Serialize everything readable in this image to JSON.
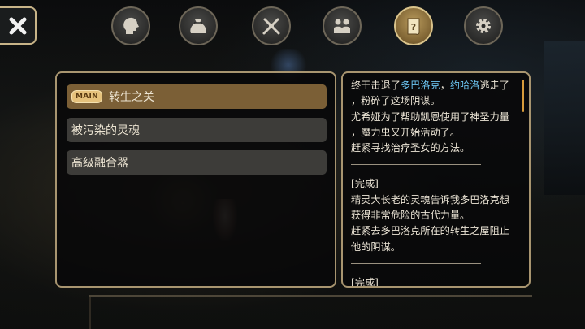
{
  "nav": {
    "close_icon": "close-x-icon",
    "buttons": [
      {
        "name": "character-tab",
        "icon": "head-silhouette-icon",
        "active": false
      },
      {
        "name": "inventory-tab",
        "icon": "bag-icon",
        "active": false
      },
      {
        "name": "skill-tab",
        "icon": "crossed-swords-icon",
        "active": false
      },
      {
        "name": "party-tab",
        "icon": "group-icon",
        "active": false
      },
      {
        "name": "quest-tab",
        "icon": "scroll-icon",
        "active": true
      },
      {
        "name": "settings-tab",
        "icon": "gear-icon",
        "active": false
      }
    ]
  },
  "quests": {
    "main_badge": "MAIN",
    "items": [
      {
        "label": "转生之关",
        "selected": true,
        "main": true
      },
      {
        "label": "被污染的灵魂",
        "selected": false,
        "main": false
      },
      {
        "label": "高级融合器",
        "selected": false,
        "main": false
      }
    ]
  },
  "detail": {
    "entry1": {
      "l1_pre": "终于击退了",
      "l1_name1": "多巴洛克",
      "l1_comma": "，",
      "l1_name2": "约哈洛",
      "l1_post": "逃走了",
      "l2": "，粉碎了这场阴谋。",
      "l3": "尤希娅为了帮助凯恩使用了神圣力量",
      "l4": "，魔力虫又开始活动了。",
      "l5": "赶紧寻找治疗圣女的方法。"
    },
    "entry2": {
      "status": "[完成]",
      "l1": "精灵大长老的灵魂告诉我多巴洛克想",
      "l2": "获得非常危险的古代力量。",
      "l3": "赶紧去多巴洛克所在的转生之屋阻止",
      "l4": "他的阴谋。"
    },
    "entry3": {
      "status": "[完成]"
    }
  },
  "colors": {
    "accent_gold": "#c8b488",
    "selected_item": "#7b5f36",
    "highlight_name": "#6cc5f2"
  }
}
